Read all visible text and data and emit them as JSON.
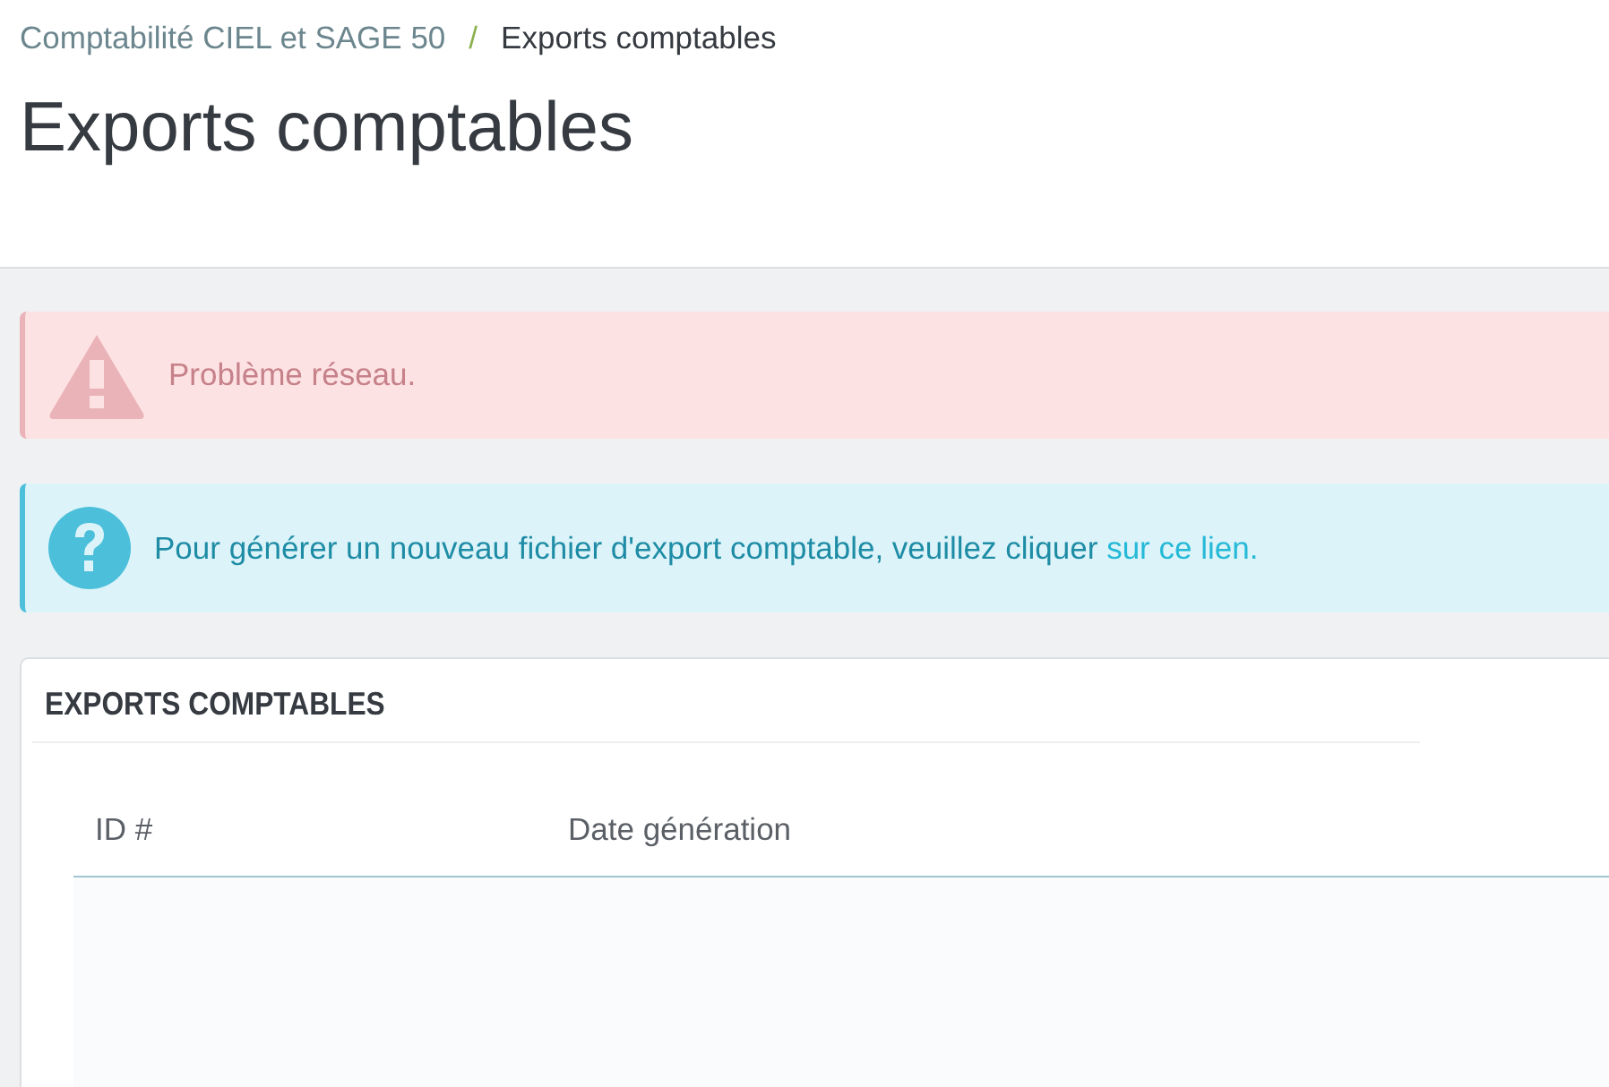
{
  "breadcrumb": {
    "separator": "/",
    "items": [
      {
        "label": "Comptabilité CIEL et SAGE 50",
        "current": false
      },
      {
        "label": "Exports comptables",
        "current": true
      }
    ]
  },
  "page_title": "Exports comptables",
  "alerts": [
    {
      "kind": "danger",
      "text": "Problème réseau."
    },
    {
      "kind": "info",
      "text": "Pour générer un nouveau fichier d'export comptable, veuillez cliquer ",
      "link": "sur ce lien."
    }
  ],
  "panel": {
    "title": "EXPORTS COMPTABLES",
    "table": {
      "columns": [
        "ID #",
        "Date génération"
      ]
    }
  }
}
